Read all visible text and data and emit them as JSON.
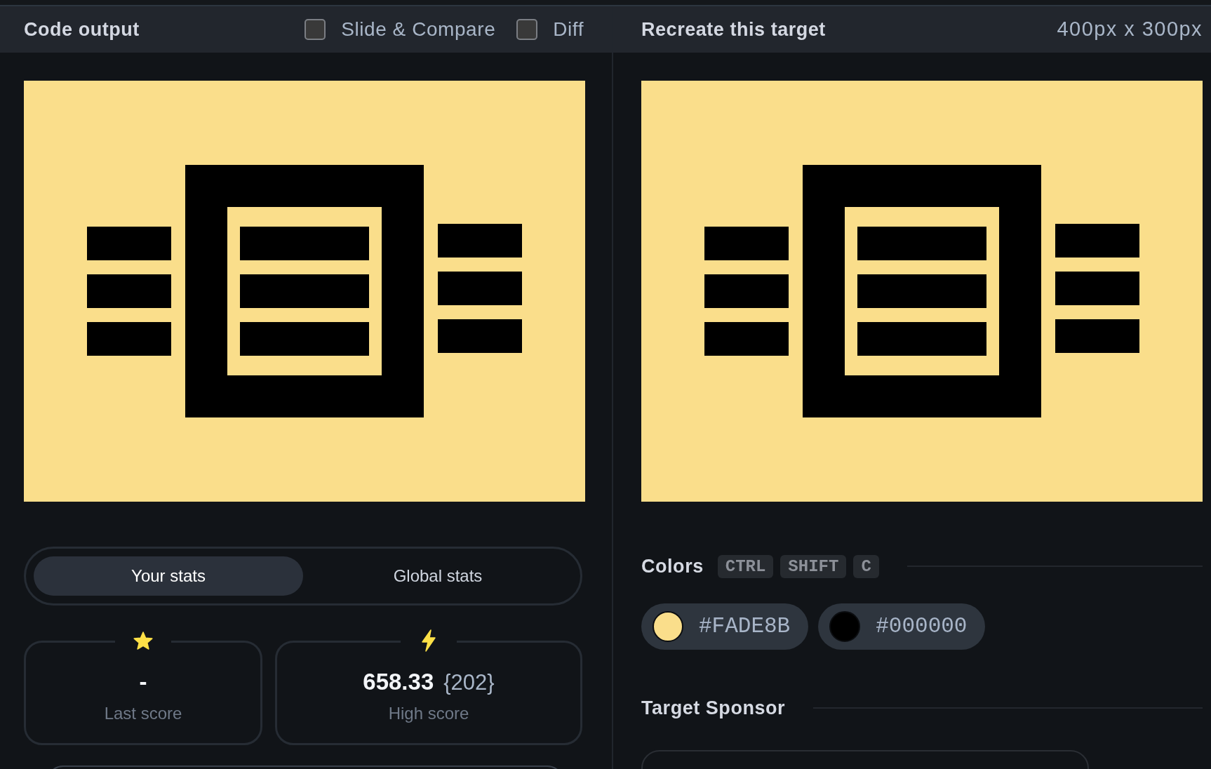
{
  "code_output": {
    "title": "Code output",
    "options": [
      {
        "label": "Slide & Compare",
        "checked": false
      },
      {
        "label": "Diff",
        "checked": false
      }
    ]
  },
  "target": {
    "title": "Recreate this target",
    "size": "400px x 300px"
  },
  "stats": {
    "tabs": [
      {
        "label": "Your stats",
        "selected": true
      },
      {
        "label": "Global stats",
        "selected": false
      }
    ],
    "cards": [
      {
        "kind": "star",
        "value": "-",
        "label": "Last score"
      },
      {
        "kind": "bolt",
        "value": "658.33",
        "extra": "{202}",
        "label": "High score"
      }
    ]
  },
  "colors": {
    "title": "Colors",
    "shortcut": [
      "CTRL",
      "SHIFT",
      "C"
    ],
    "swatches": [
      {
        "hex": "#FADE8B",
        "color": "#fade8b"
      },
      {
        "hex": "#000000",
        "color": "#000000"
      }
    ]
  },
  "sponsor": {
    "title": "Target Sponsor"
  }
}
